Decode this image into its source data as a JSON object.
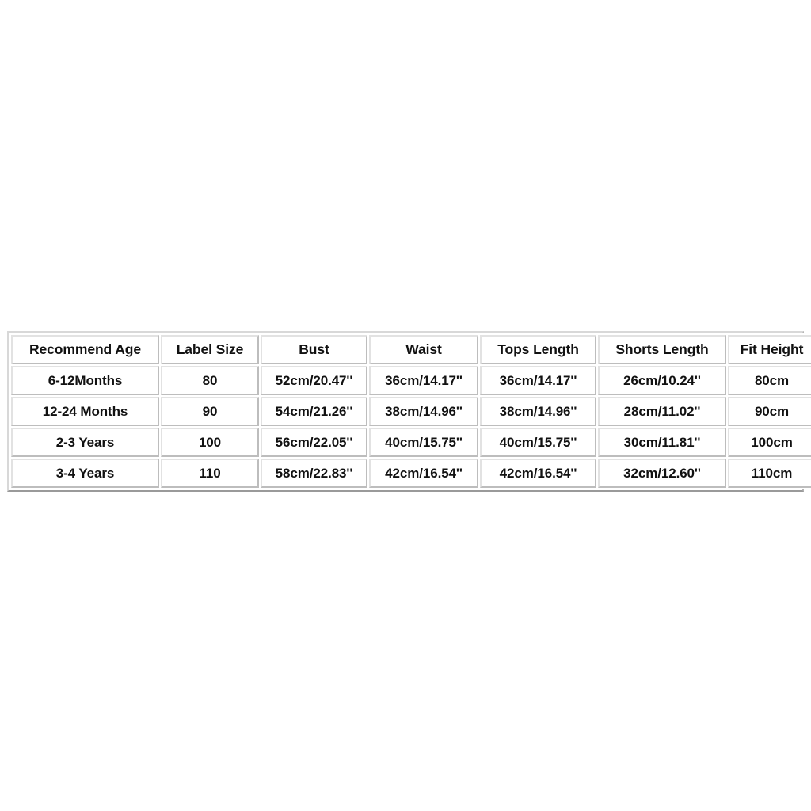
{
  "page": {
    "background_color": "#ffffff",
    "text_color": "#111111",
    "border_color": "#c9c9c9"
  },
  "size_table": {
    "name": "size-chart-table",
    "columns": [
      "Recommend Age",
      "Label Size",
      "Bust",
      "Waist",
      "Tops Length",
      "Shorts Length",
      "Fit Height"
    ],
    "rows": [
      {
        "recommend_age": "6-12Months",
        "label_size": "80",
        "bust": "52cm/20.47''",
        "waist": "36cm/14.17''",
        "tops_length": "36cm/14.17''",
        "shorts_length": "26cm/10.24''",
        "fit_height": "80cm"
      },
      {
        "recommend_age": "12-24 Months",
        "label_size": "90",
        "bust": "54cm/21.26''",
        "waist": "38cm/14.96''",
        "tops_length": "38cm/14.96''",
        "shorts_length": "28cm/11.02''",
        "fit_height": "90cm"
      },
      {
        "recommend_age": "2-3 Years",
        "label_size": "100",
        "bust": "56cm/22.05''",
        "waist": "40cm/15.75''",
        "tops_length": "40cm/15.75''",
        "shorts_length": "30cm/11.81''",
        "fit_height": "100cm"
      },
      {
        "recommend_age": "3-4 Years",
        "label_size": "110",
        "bust": "58cm/22.83''",
        "waist": "42cm/16.54''",
        "tops_length": "42cm/16.54''",
        "shorts_length": "32cm/12.60''",
        "fit_height": "110cm"
      }
    ]
  }
}
